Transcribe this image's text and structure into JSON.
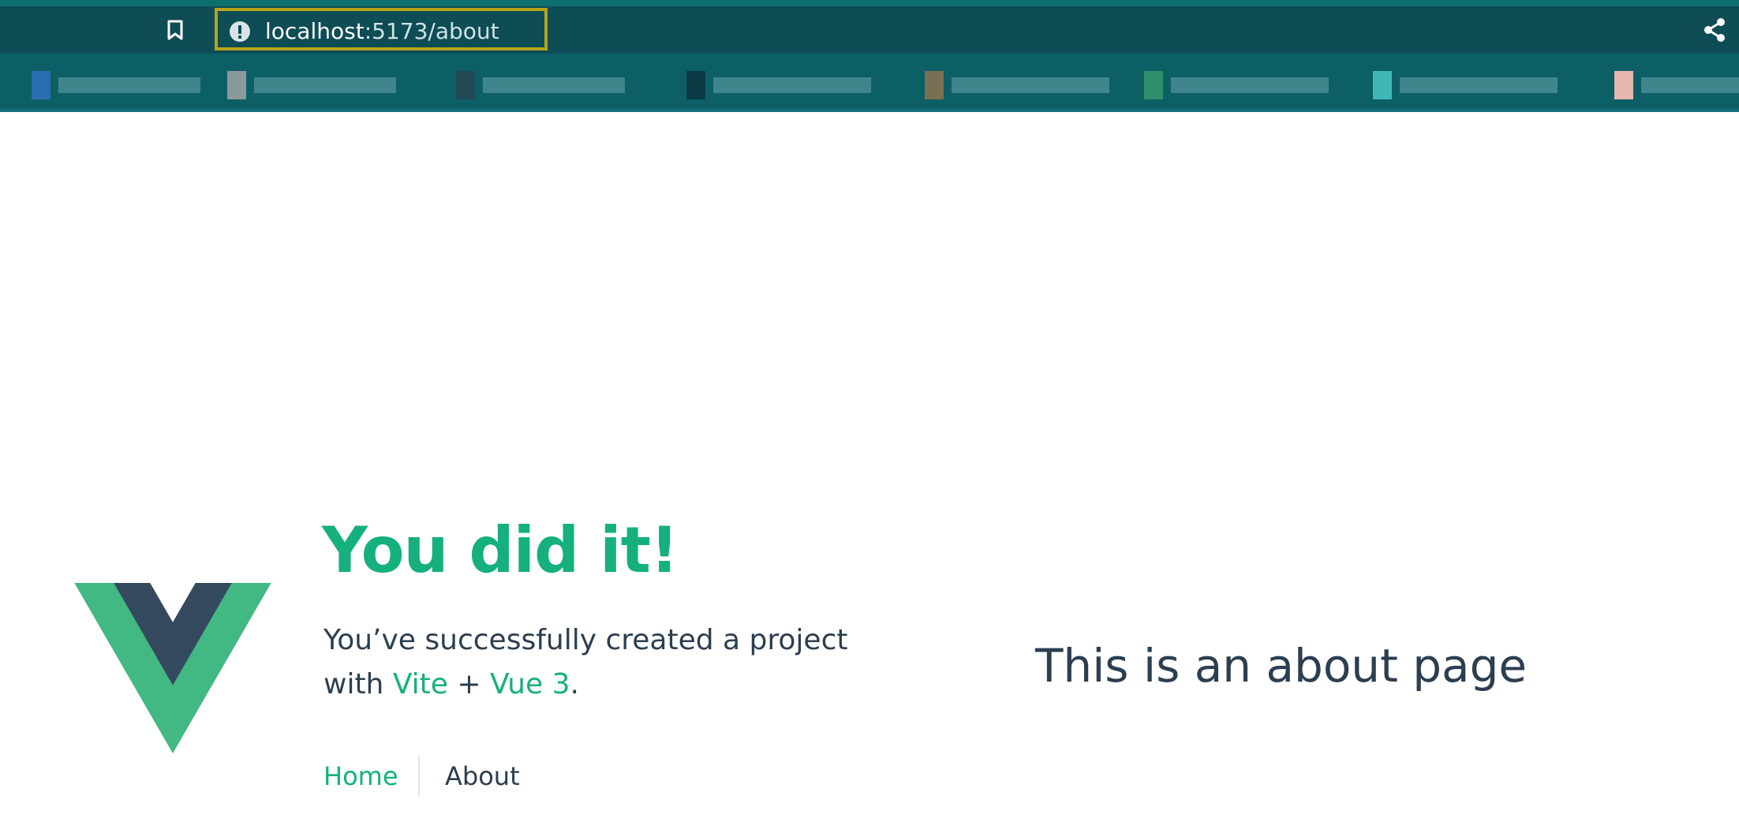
{
  "browser": {
    "url_host": "localhost",
    "url_path": ":5173/about",
    "bookmarks_count_visible": 8
  },
  "page": {
    "hero_title": "You did it!",
    "hero_line1": "You’ve successfully created a project",
    "hero_with": "with ",
    "hero_vite": "Vite",
    "hero_plus": " + ",
    "hero_vue": "Vue 3",
    "hero_period": ".",
    "nav_home": "Home",
    "nav_about": "About",
    "about_heading": "This is an about page"
  },
  "colors": {
    "vue_green": "#42b883",
    "vue_dark": "#35495e",
    "accent_green": "#15b07d",
    "text": "#2c3e50",
    "chrome_teal": "#0e4c56",
    "url_highlight": "#b8a31a"
  }
}
